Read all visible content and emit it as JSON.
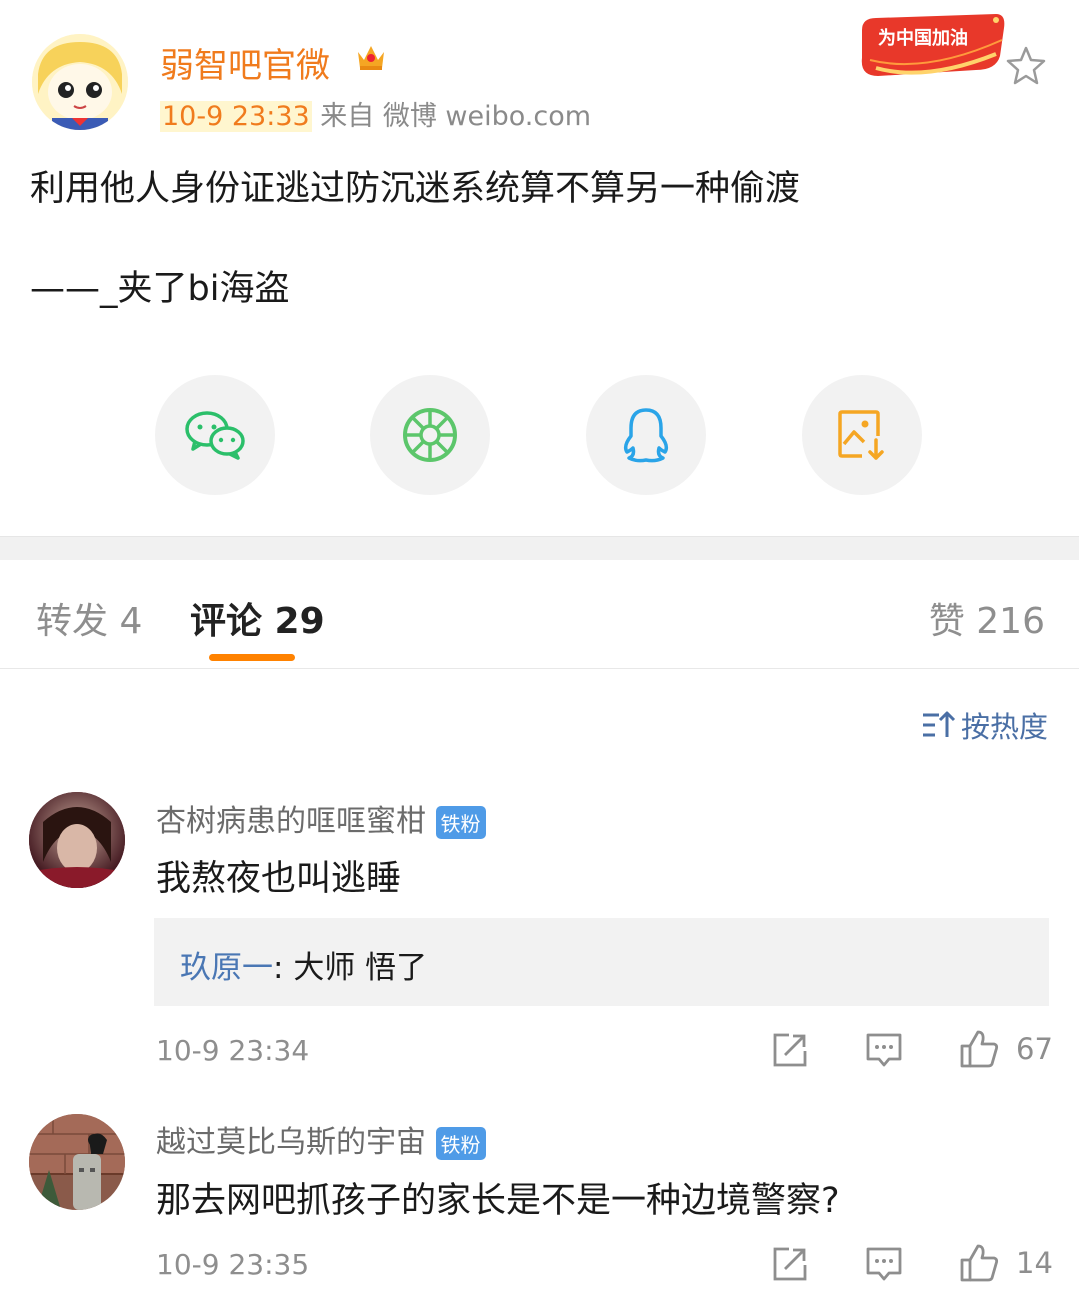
{
  "post": {
    "username": "弱智吧官微",
    "time": "10-9 23:33",
    "source": "来自 微博 weibo.com",
    "badge_text": "为中国加油",
    "text": "利用他人身份证逃过防沉迷系统算不算另一种偷渡",
    "author_line": "——_夹了bi海盗"
  },
  "share": [
    "wechat-icon",
    "moments-icon",
    "qq-icon",
    "save-image-icon"
  ],
  "tabs": {
    "repost": "转发 4",
    "comment": "评论 29",
    "like": "赞 216"
  },
  "sort": {
    "label": "按热度"
  },
  "comments": [
    {
      "name": "杏树病患的哐哐蜜柑",
      "badge": "铁粉",
      "text": "我熬夜也叫逃睡",
      "reply_name": "玖原一",
      "reply_sep": ": ",
      "reply_text": "大师 悟了",
      "time": "10-9 23:34",
      "likes": "67"
    },
    {
      "name": "越过莫比乌斯的宇宙",
      "badge": "铁粉",
      "text": "那去网吧抓孩子的家长是不是一种边境警察?",
      "time": "10-9 23:35",
      "likes": "14"
    }
  ],
  "colors": {
    "accent": "#ff8200",
    "username": "#f07b1d",
    "link": "#4a77b4",
    "fan_badge": "#4f9be7"
  }
}
